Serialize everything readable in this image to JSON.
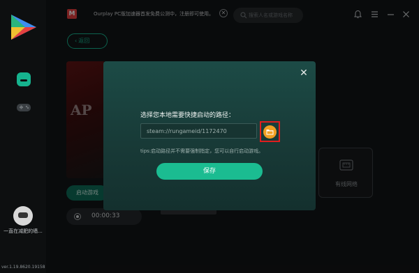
{
  "sidebar": {
    "username": "一直在减肥的墙...",
    "version": "ver.1.19.8620.19158"
  },
  "topbar": {
    "notice": "Ourplay PC版加速器首发免费公测中，注册即可使用。",
    "search_placeholder": "搜索人名或游戏名称",
    "close_glyph": "✕"
  },
  "page": {
    "back_label": "返回",
    "back_chevron": "‹",
    "cover_text": "AP",
    "start_label": "启动游戏",
    "timer": "00:00:33",
    "net_card_label": "有线网络"
  },
  "dialog": {
    "title": "选择您本地需要快捷启动的路径：",
    "path_value": "steam://rungameid/1172470",
    "tip": "tips:启动路径并不需要强制指定，您可以自行启动游戏。",
    "save_label": "保存",
    "close_glyph": "✕"
  },
  "colors": {
    "accent": "#1bbc91",
    "folder_button": "#f0a023",
    "highlight_box": "#e01e1e",
    "dialog_bg": "#1c4b46"
  }
}
